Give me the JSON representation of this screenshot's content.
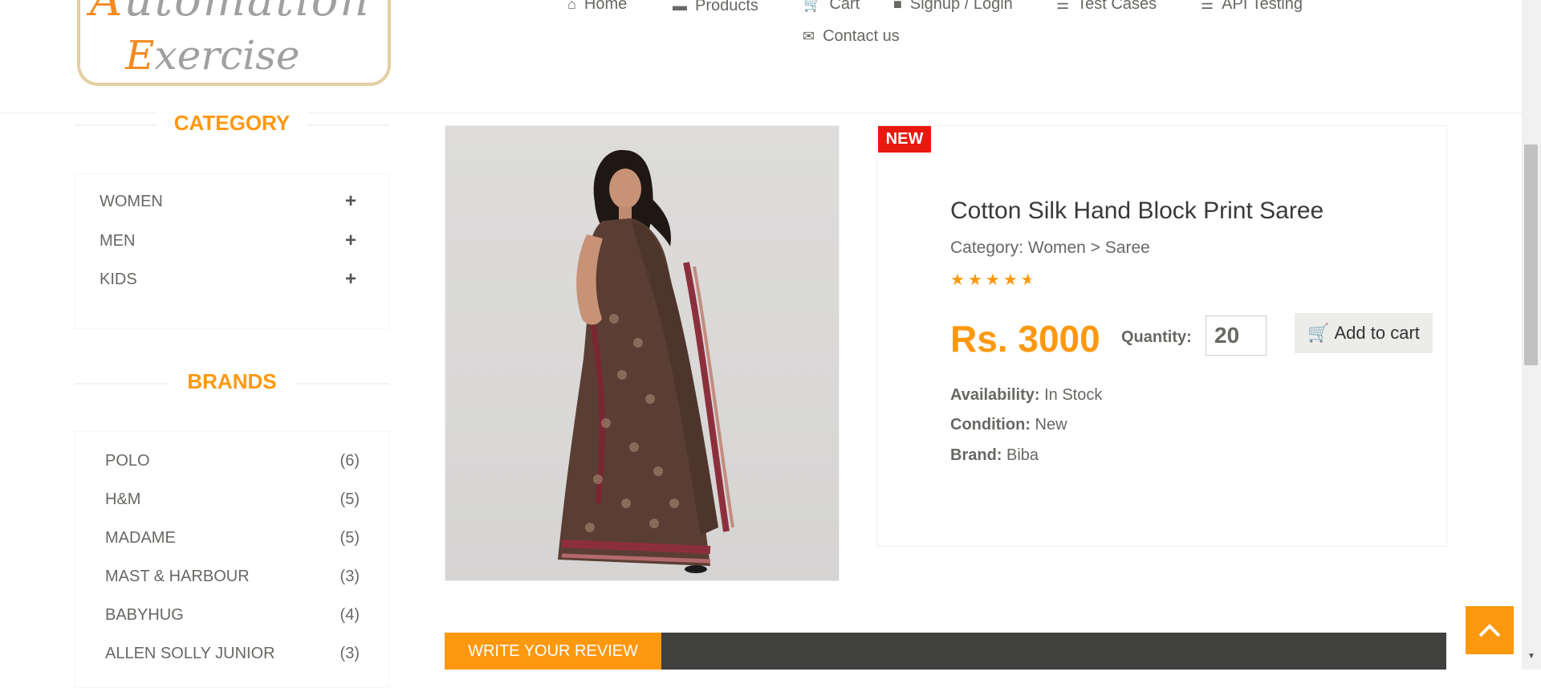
{
  "logo": {
    "line1": "Automation",
    "line2": "Exercise"
  },
  "nav": {
    "home": "Home",
    "products": "Products",
    "cart": "Cart",
    "signup": "Signup / Login",
    "test_cases": "Test Cases",
    "api_testing": "API Testing",
    "contact": "Contact us"
  },
  "sidebar": {
    "category_title": "CATEGORY",
    "categories": [
      {
        "label": "WOMEN",
        "icon": "plus-icon"
      },
      {
        "label": "MEN",
        "icon": "plus-icon"
      },
      {
        "label": "KIDS",
        "icon": "plus-icon"
      }
    ],
    "brands_title": "BRANDS",
    "brands": [
      {
        "label": "POLO",
        "count": "(6)"
      },
      {
        "label": "H&M",
        "count": "(5)"
      },
      {
        "label": "MADAME",
        "count": "(5)"
      },
      {
        "label": "MAST & HARBOUR",
        "count": "(3)"
      },
      {
        "label": "BABYHUG",
        "count": "(4)"
      },
      {
        "label": "ALLEN SOLLY JUNIOR",
        "count": "(3)"
      }
    ]
  },
  "product": {
    "badge": "NEW",
    "name": "Cotton Silk Hand Block Print Saree",
    "category": "Category: Women > Saree",
    "rating": 4.5,
    "price": "Rs. 3000",
    "quantity_label": "Quantity:",
    "quantity_value": "20",
    "add_to_cart": "Add to cart",
    "availability_label": "Availability:",
    "availability_value": "In Stock",
    "condition_label": "Condition:",
    "condition_value": "New",
    "brand_label": "Brand:",
    "brand_value": "Biba"
  },
  "review": {
    "tab_label": "WRITE YOUR REVIEW"
  },
  "colors": {
    "accent": "#fe980f",
    "badge": "#e8190f",
    "review_bar": "#40403e"
  }
}
